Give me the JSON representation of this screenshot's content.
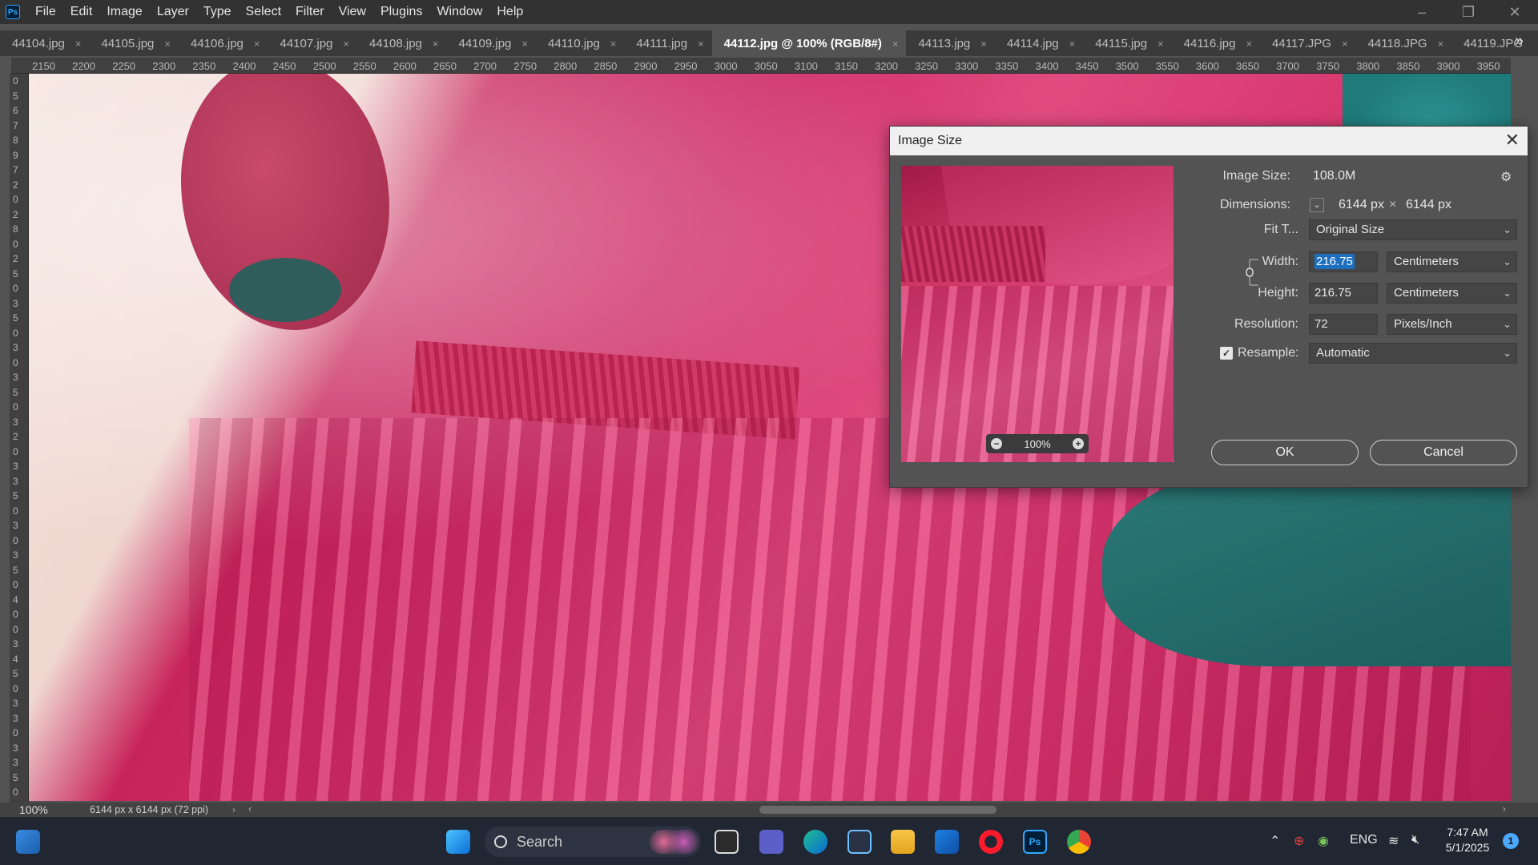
{
  "app": {
    "logo": "Ps"
  },
  "menu": [
    "File",
    "Edit",
    "Image",
    "Layer",
    "Type",
    "Select",
    "Filter",
    "View",
    "Plugins",
    "Window",
    "Help"
  ],
  "window_controls": {
    "minimize": "–",
    "restore": "❐",
    "close": "✕"
  },
  "tabs": [
    {
      "label": "44104.jpg"
    },
    {
      "label": "44105.jpg"
    },
    {
      "label": "44106.jpg"
    },
    {
      "label": "44107.jpg"
    },
    {
      "label": "44108.jpg"
    },
    {
      "label": "44109.jpg"
    },
    {
      "label": "44110.jpg"
    },
    {
      "label": "44111.jpg"
    },
    {
      "label": "44112.jpg @ 100% (RGB/8#)",
      "active": true
    },
    {
      "label": "44113.jpg"
    },
    {
      "label": "44114.jpg"
    },
    {
      "label": "44115.jpg"
    },
    {
      "label": "44116.jpg"
    },
    {
      "label": "44117.JPG"
    },
    {
      "label": "44118.JPG"
    },
    {
      "label": "44119.JPG"
    }
  ],
  "tab_close": "×",
  "tab_more": "»",
  "ruler_h": [
    "2150",
    "2200",
    "2250",
    "2300",
    "2350",
    "2400",
    "2450",
    "2500",
    "2550",
    "2600",
    "2650",
    "2700",
    "2750",
    "2800",
    "2850",
    "2900",
    "2950",
    "3000",
    "3050",
    "3100",
    "3150",
    "3200",
    "3250",
    "3300",
    "3350",
    "3400",
    "3450",
    "3500",
    "3550",
    "3600",
    "3650",
    "3700",
    "3750",
    "3800",
    "3850",
    "3900",
    "3950"
  ],
  "ruler_v": [
    "0",
    "5",
    "6",
    "7",
    "8",
    "9",
    "7",
    "2",
    "0",
    "2",
    "8",
    "0",
    "2",
    "5",
    "0",
    "3",
    "5",
    "0",
    "3",
    "0",
    "3",
    "5",
    "0",
    "3",
    "2",
    "0",
    "3",
    "3",
    "5",
    "0",
    "3",
    "0",
    "3",
    "5",
    "0",
    "4",
    "0",
    "0",
    "3",
    "4",
    "5",
    "0",
    "3",
    "3",
    "0",
    "3",
    "3",
    "5",
    "0"
  ],
  "status": {
    "zoom": "100%",
    "doc_info": "6144 px x 6144 px (72 ppi)",
    "arrow": "›",
    "scroll_left": "‹",
    "scroll_right": "›"
  },
  "dialog": {
    "title": "Image Size",
    "close": "✕",
    "image_size_label": "Image Size:",
    "image_size_value": "108.0M",
    "dimensions_label": "Dimensions:",
    "dim_w": "6144 px",
    "dim_x": "×",
    "dim_h": "6144 px",
    "fit_label": "Fit T...",
    "fit_value": "Original Size",
    "width_label": "Width:",
    "width_value": "216.75",
    "width_unit": "Centimeters",
    "height_label": "Height:",
    "height_value": "216.75",
    "height_unit": "Centimeters",
    "resolution_label": "Resolution:",
    "resolution_value": "72",
    "resolution_unit": "Pixels/Inch",
    "resample_label": "Resample:",
    "resample_value": "Automatic",
    "resample_checked": true,
    "preview_zoom": "100%",
    "ok": "OK",
    "cancel": "Cancel"
  },
  "taskbar": {
    "search": "Search",
    "lang": "ENG",
    "time": "7:47 AM",
    "date": "5/1/2025",
    "notifications": "1"
  }
}
